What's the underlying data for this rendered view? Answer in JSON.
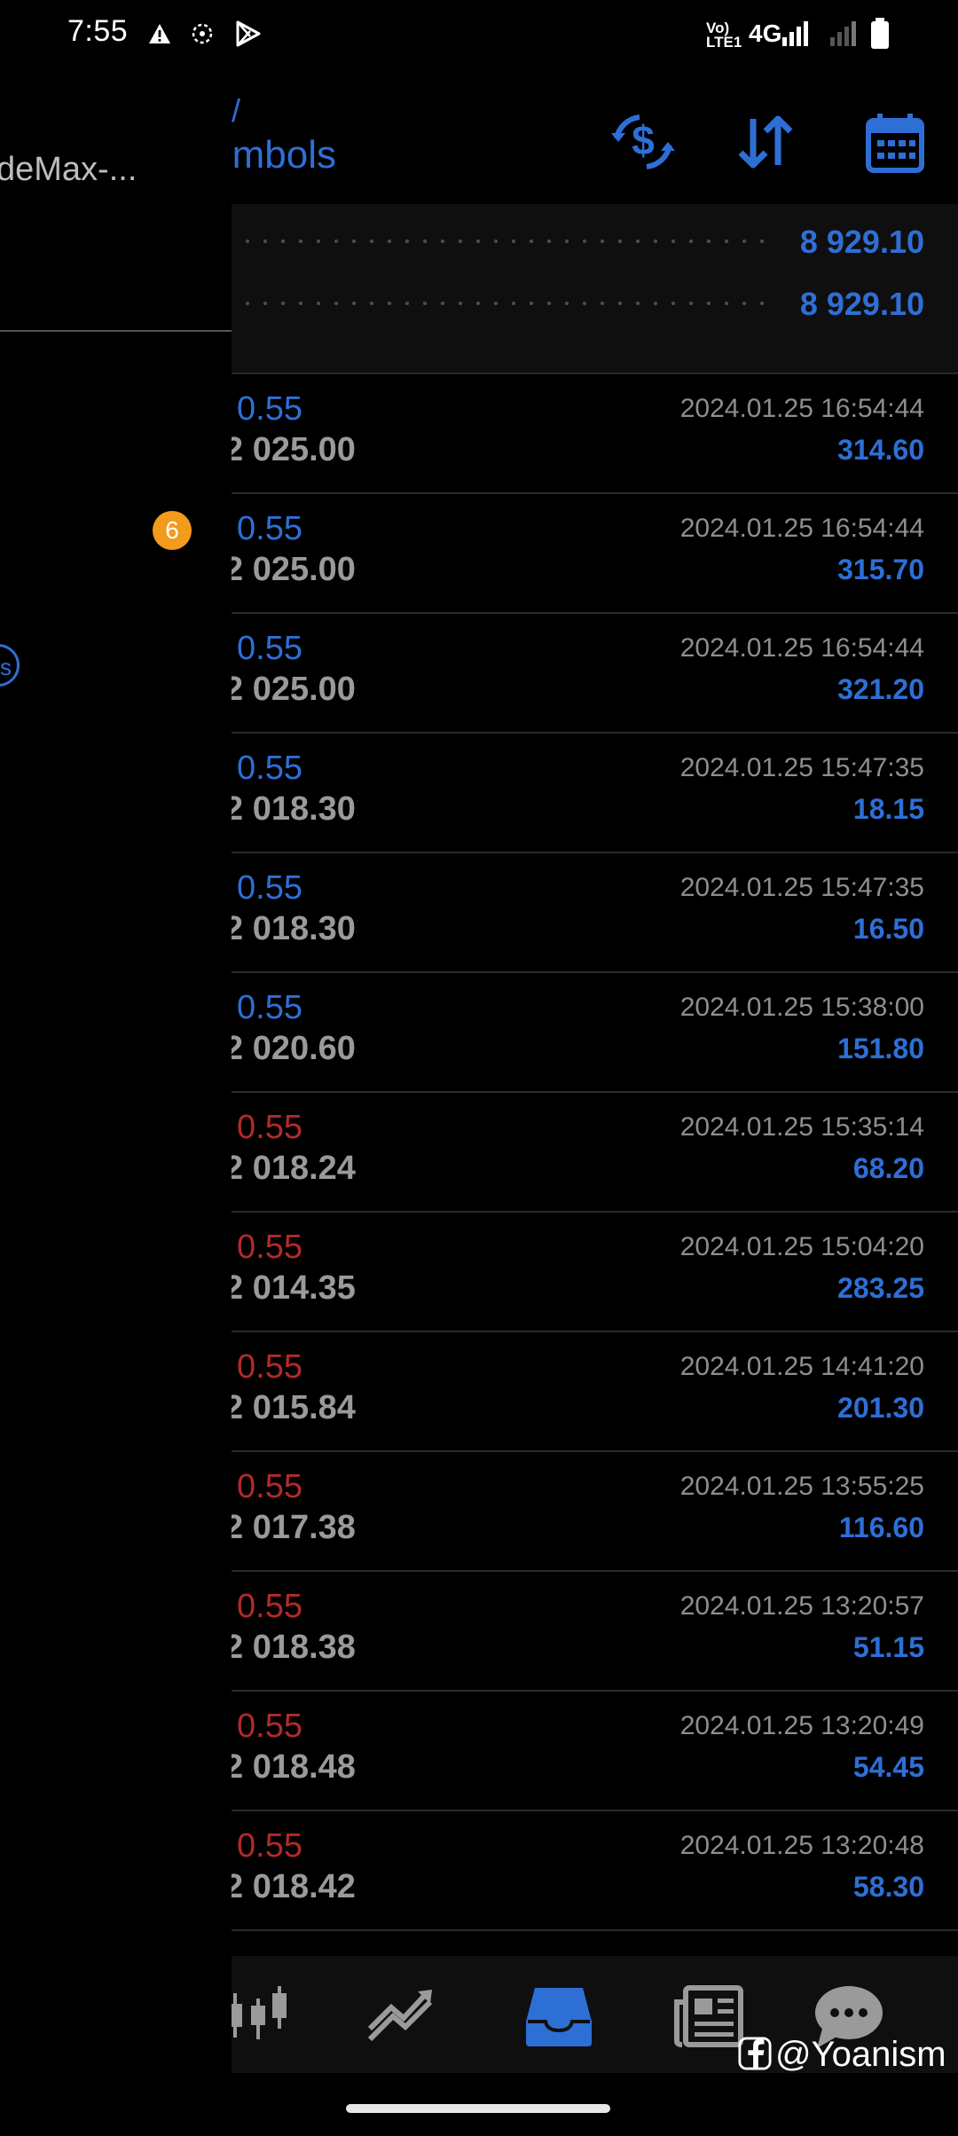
{
  "status_bar": {
    "time": "7:55",
    "network_label": "4G",
    "volte_label": "Vo) LTE1"
  },
  "drawer": {
    "account_name": "deMax-...",
    "notification_badge": "6",
    "ring_letter": "s"
  },
  "header": {
    "title": "rmbols",
    "title_prefix": "/",
    "buttons": [
      {
        "name": "currency-exchange-icon"
      },
      {
        "name": "sort-icon"
      },
      {
        "name": "calendar-icon"
      }
    ]
  },
  "balance": {
    "value_1": "8 929.10",
    "value_2": "8 929.10"
  },
  "deals": [
    {
      "lots": "0.55",
      "price": "2 025.00",
      "time": "2024.01.25 16:54:44",
      "profit": "314.60",
      "color": "blue"
    },
    {
      "lots": "0.55",
      "price": "2 025.00",
      "time": "2024.01.25 16:54:44",
      "profit": "315.70",
      "color": "blue"
    },
    {
      "lots": "0.55",
      "price": "2 025.00",
      "time": "2024.01.25 16:54:44",
      "profit": "321.20",
      "color": "blue"
    },
    {
      "lots": "0.55",
      "price": "2 018.30",
      "time": "2024.01.25 15:47:35",
      "profit": "18.15",
      "color": "blue"
    },
    {
      "lots": "0.55",
      "price": "2 018.30",
      "time": "2024.01.25 15:47:35",
      "profit": "16.50",
      "color": "blue"
    },
    {
      "lots": "0.55",
      "price": "2 020.60",
      "time": "2024.01.25 15:38:00",
      "profit": "151.80",
      "color": "blue"
    },
    {
      "lots": "0.55",
      "price": "2 018.24",
      "time": "2024.01.25 15:35:14",
      "profit": "68.20",
      "color": "red"
    },
    {
      "lots": "0.55",
      "price": "2 014.35",
      "time": "2024.01.25 15:04:20",
      "profit": "283.25",
      "color": "red"
    },
    {
      "lots": "0.55",
      "price": "2 015.84",
      "time": "2024.01.25 14:41:20",
      "profit": "201.30",
      "color": "red"
    },
    {
      "lots": "0.55",
      "price": "2 017.38",
      "time": "2024.01.25 13:55:25",
      "profit": "116.60",
      "color": "red"
    },
    {
      "lots": "0.55",
      "price": "2 018.38",
      "time": "2024.01.25 13:20:57",
      "profit": "51.15",
      "color": "red"
    },
    {
      "lots": "0.55",
      "price": "2 018.48",
      "time": "2024.01.25 13:20:49",
      "profit": "54.45",
      "color": "red"
    },
    {
      "lots": "0.55",
      "price": "2 018.42",
      "time": "2024.01.25 13:20:48",
      "profit": "58.30",
      "color": "red"
    }
  ],
  "bottom_nav": [
    {
      "name": "nav-chart-icon",
      "active": false
    },
    {
      "name": "nav-trade-icon",
      "active": false
    },
    {
      "name": "nav-history-icon",
      "active": true
    },
    {
      "name": "nav-news-icon",
      "active": false
    },
    {
      "name": "nav-chat-icon",
      "active": false
    }
  ],
  "colors": {
    "accent_blue": "#2e6fd6",
    "loss_red": "#b12a2a",
    "badge_orange": "#f39b1c",
    "muted_gray": "#8e8e8e"
  },
  "watermark": "@Yoanism"
}
